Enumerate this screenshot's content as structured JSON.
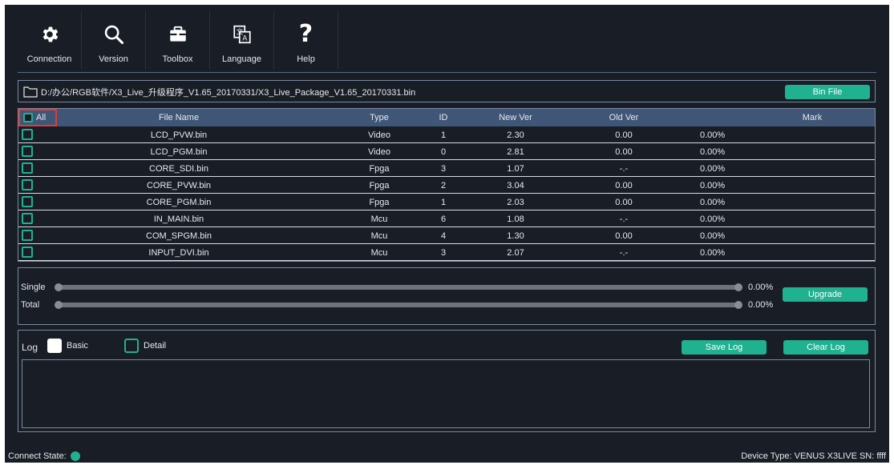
{
  "toolbar": [
    {
      "label": "Connection",
      "icon": "gear-icon"
    },
    {
      "label": "Version",
      "icon": "search-icon"
    },
    {
      "label": "Toolbox",
      "icon": "toolbox-icon"
    },
    {
      "label": "Language",
      "icon": "language-icon"
    },
    {
      "label": "Help",
      "icon": "help-icon"
    }
  ],
  "file": {
    "path": "D:/办公/RGB软件/X3_Live_升级程序_V1.65_20170331/X3_Live_Package_V1.65_20170331.bin",
    "bin_button": "Bin File"
  },
  "table": {
    "headers": {
      "all": "All",
      "file_name": "File Name",
      "type": "Type",
      "id": "ID",
      "new_ver": "New Ver",
      "old_ver": "Old Ver",
      "mark": "Mark"
    },
    "rows": [
      {
        "name": "LCD_PVW.bin",
        "type": "Video",
        "id": "1",
        "new_ver": "2.30",
        "old_ver": "0.00",
        "progress": "0.00%"
      },
      {
        "name": "LCD_PGM.bin",
        "type": "Video",
        "id": "0",
        "new_ver": "2.81",
        "old_ver": "0.00",
        "progress": "0.00%"
      },
      {
        "name": "CORE_SDI.bin",
        "type": "Fpga",
        "id": "3",
        "new_ver": "1.07",
        "old_ver": "-.-",
        "progress": "0.00%"
      },
      {
        "name": "CORE_PVW.bin",
        "type": "Fpga",
        "id": "2",
        "new_ver": "3.04",
        "old_ver": "0.00",
        "progress": "0.00%"
      },
      {
        "name": "CORE_PGM.bin",
        "type": "Fpga",
        "id": "1",
        "new_ver": "2.03",
        "old_ver": "0.00",
        "progress": "0.00%"
      },
      {
        "name": "IN_MAIN.bin",
        "type": "Mcu",
        "id": "6",
        "new_ver": "1.08",
        "old_ver": "-.-",
        "progress": "0.00%"
      },
      {
        "name": "COM_SPGM.bin",
        "type": "Mcu",
        "id": "4",
        "new_ver": "1.30",
        "old_ver": "0.00",
        "progress": "0.00%"
      },
      {
        "name": "INPUT_DVI.bin",
        "type": "Mcu",
        "id": "3",
        "new_ver": "2.07",
        "old_ver": "-.-",
        "progress": "0.00%"
      }
    ]
  },
  "progress": {
    "single_label": "Single",
    "single_value": "0.00%",
    "total_label": "Total",
    "total_value": "0.00%",
    "upgrade_button": "Upgrade"
  },
  "log": {
    "title": "Log",
    "basic_label": "Basic",
    "detail_label": "Detail",
    "save_button": "Save Log",
    "clear_button": "Clear Log"
  },
  "status": {
    "connect_label": "Connect State:",
    "device_text": "Device Type: VENUS X3LIVE SN: ffff"
  },
  "colors": {
    "accent": "#1fb190",
    "background": "#181d26",
    "header": "#3f5677"
  }
}
